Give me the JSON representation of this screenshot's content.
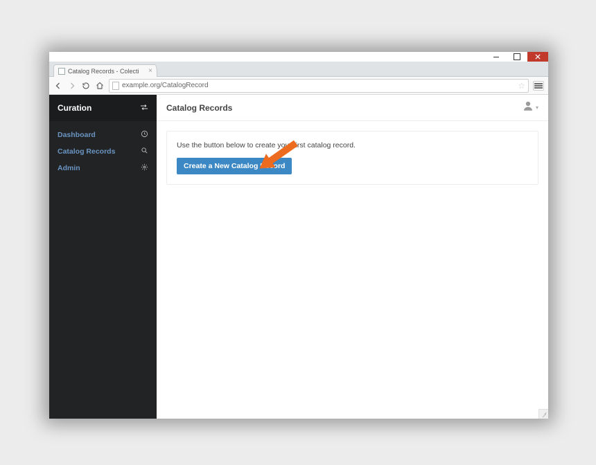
{
  "browser": {
    "tab_title": "Catalog Records - Colecti",
    "url": "example.org/CatalogRecord"
  },
  "sidebar": {
    "brand": "Curation",
    "items": [
      {
        "label": "Dashboard",
        "icon": "clock-icon"
      },
      {
        "label": "Catalog Records",
        "icon": "search-icon"
      },
      {
        "label": "Admin",
        "icon": "gear-icon"
      }
    ]
  },
  "main": {
    "title": "Catalog Records",
    "instruction": "Use the button below to create your first catalog record.",
    "cta_label": "Create a New Catalog Record"
  }
}
